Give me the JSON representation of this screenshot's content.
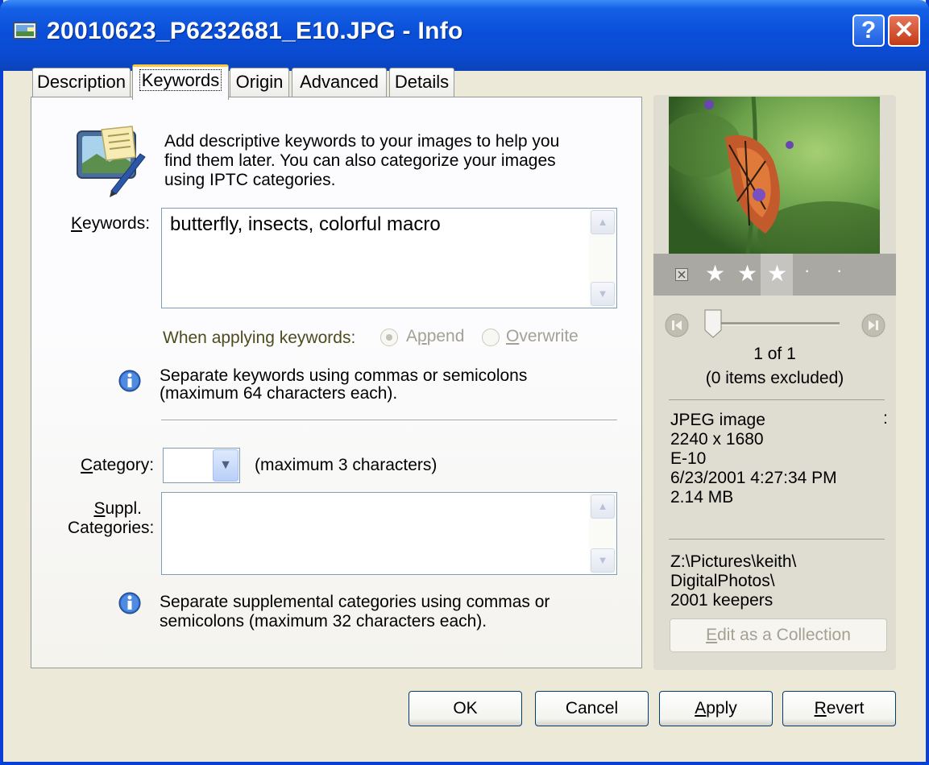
{
  "window": {
    "title": "20010623_P6232681_E10.JPG - Info",
    "help_glyph": "?",
    "close_glyph": "✕"
  },
  "tabs": [
    {
      "label": "Description"
    },
    {
      "label": "Keywords"
    },
    {
      "label": "Origin"
    },
    {
      "label": "Advanced"
    },
    {
      "label": "Details"
    }
  ],
  "keywords_tab": {
    "intro_lines": [
      "Add descriptive keywords to your images to help you",
      "find them later. You can also categorize your images",
      "using IPTC categories."
    ],
    "keywords_label": "Keywords:",
    "keywords_value": "butterfly, insects, colorful macro",
    "apply_label": "When applying keywords:",
    "append_label": "Append",
    "overwrite_label": "Overwrite",
    "mode_selected": "Append",
    "keywords_hint_lines": [
      "Separate keywords using commas or semicolons",
      "(maximum 64 characters each)."
    ],
    "category_label": "Category:",
    "category_value": "",
    "category_hint": "(maximum 3 characters)",
    "suppl_label_lines": [
      "Suppl.",
      "Categories:"
    ],
    "suppl_value": "",
    "suppl_hint_lines": [
      "Separate supplemental categories using commas or",
      "semicolons (maximum 32 characters each)."
    ]
  },
  "side": {
    "rating": {
      "stars": 3,
      "max": 5
    },
    "position_text": "1 of 1",
    "excluded_text": "(0 items excluded)",
    "colon_mark": ":",
    "meta": [
      "JPEG image",
      "2240 x 1680",
      "E-10",
      "6/23/2001 4:27:34 PM",
      "2.14 MB"
    ],
    "path": [
      "Z:\\Pictures\\keith\\",
      "DigitalPhotos\\",
      "2001  keepers"
    ],
    "edit_collection_label": "Edit as a Collection"
  },
  "buttons": {
    "ok": "OK",
    "cancel": "Cancel",
    "apply": "Apply",
    "revert": "Revert"
  },
  "colors": {
    "title_blue": "#0a4fd9",
    "dialog_bg": "#ece9d8",
    "tab_highlight": "#ffc83c",
    "olive_text": "#4e4b1e"
  }
}
